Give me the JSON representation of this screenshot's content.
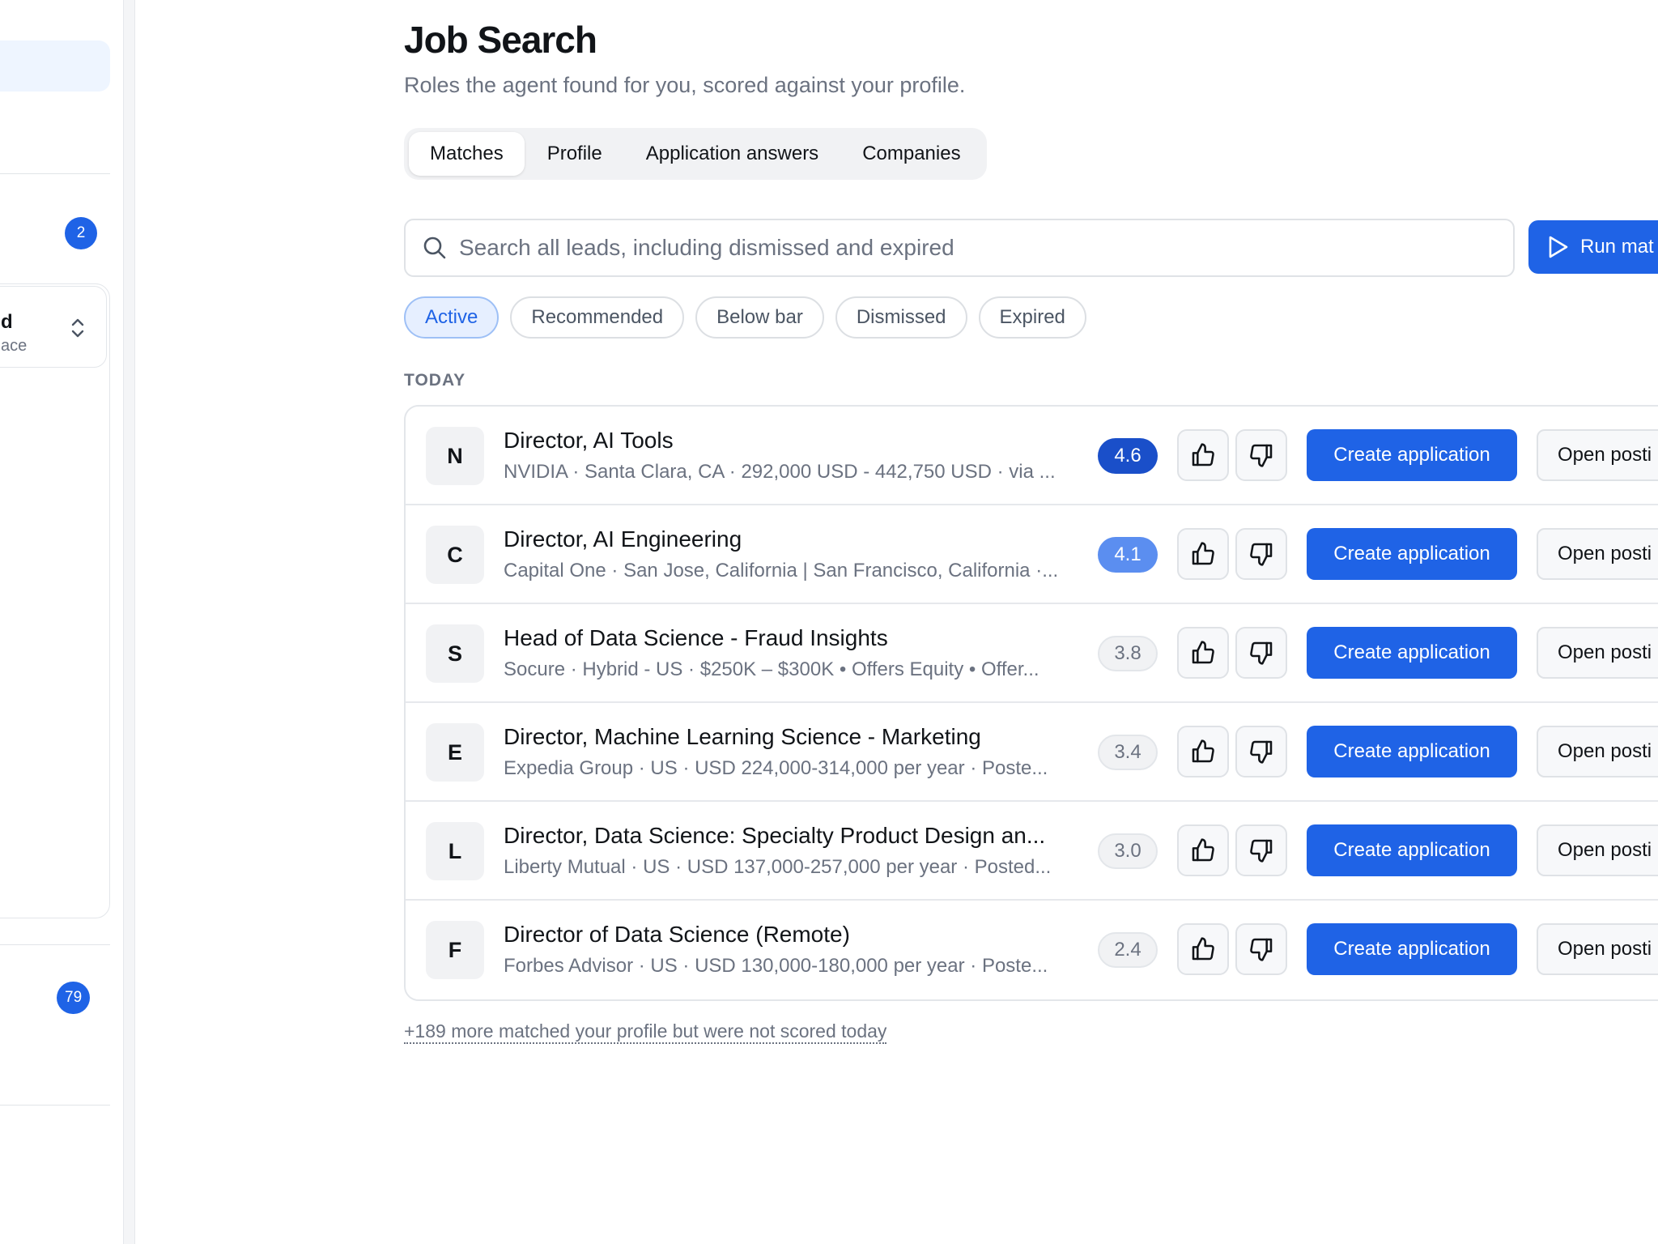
{
  "sidebar": {
    "badge_top": "2",
    "switcher_title": "d",
    "switcher_subtitle": "ace",
    "badge_bottom": "79"
  },
  "header": {
    "title": "Job Search",
    "subtitle": "Roles the agent found for you, scored against your profile."
  },
  "tabs": [
    {
      "label": "Matches",
      "active": true
    },
    {
      "label": "Profile",
      "active": false
    },
    {
      "label": "Application answers",
      "active": false
    },
    {
      "label": "Companies",
      "active": false
    }
  ],
  "search": {
    "placeholder": "Search all leads, including dismissed and expired",
    "value": ""
  },
  "run_button_label": "Run mat",
  "filters": [
    {
      "label": "Active",
      "active": true
    },
    {
      "label": "Recommended",
      "active": false
    },
    {
      "label": "Below bar",
      "active": false
    },
    {
      "label": "Dismissed",
      "active": false
    },
    {
      "label": "Expired",
      "active": false
    }
  ],
  "section_label": "TODAY",
  "jobs": [
    {
      "initial": "N",
      "title": "Director, AI Tools",
      "meta": "NVIDIA · Santa Clara, CA · 292,000 USD - 442,750 USD · via ...",
      "score": "4.6",
      "tier": "high"
    },
    {
      "initial": "C",
      "title": "Director, AI Engineering",
      "meta": "Capital One · San Jose, California | San Francisco, California ·...",
      "score": "4.1",
      "tier": "mid"
    },
    {
      "initial": "S",
      "title": "Head of Data Science - Fraud Insights",
      "meta": "Socure · Hybrid - US · $250K – $300K • Offers Equity • Offer...",
      "score": "3.8",
      "tier": "low"
    },
    {
      "initial": "E",
      "title": "Director, Machine Learning Science - Marketing",
      "meta": "Expedia Group · US · USD 224,000-314,000 per year · Poste...",
      "score": "3.4",
      "tier": "low"
    },
    {
      "initial": "L",
      "title": "Director, Data Science: Specialty Product Design an...",
      "meta": "Liberty Mutual · US · USD 137,000-257,000 per year · Posted...",
      "score": "3.0",
      "tier": "low"
    },
    {
      "initial": "F",
      "title": "Director of Data Science (Remote)",
      "meta": "Forbes Advisor · US · USD 130,000-180,000 per year · Poste...",
      "score": "2.4",
      "tier": "low"
    }
  ],
  "actions": {
    "create_label": "Create application",
    "open_label": "Open posti"
  },
  "more_link": "+189 more matched your profile but were not scored today",
  "colors": {
    "accent": "#1f63e6",
    "score_high": "#1a4fc9",
    "score_mid": "#5b8ef0"
  }
}
